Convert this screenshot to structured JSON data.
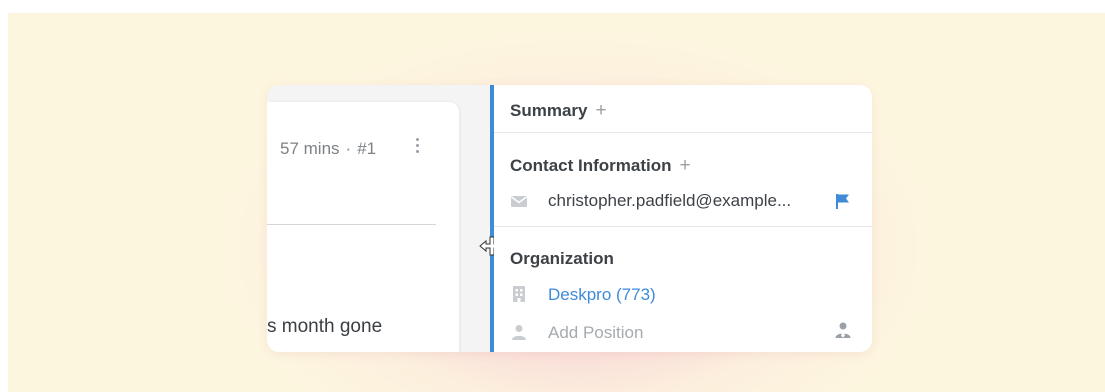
{
  "ticket_card": {
    "time_ago": "57 mins",
    "separator": "·",
    "ticket_number": "#1",
    "message_snippet": "s month gone"
  },
  "sidebar": {
    "summary": {
      "title": "Summary",
      "add_icon": "+"
    },
    "contact_information": {
      "title": "Contact Information",
      "add_icon": "+",
      "email": "christopher.padfield@example...",
      "email_icon": "envelope-icon",
      "primary_flag_icon": "flag-icon"
    },
    "organization": {
      "title": "Organization",
      "name": "Deskpro (773)",
      "org_icon": "building-icon",
      "position_placeholder": "Add Position",
      "position_icon": "person-icon",
      "manager_icon": "user-tie-icon"
    }
  },
  "colors": {
    "accent": "#3f8bd8",
    "link": "#3f8bd8",
    "background_warm": "#fdf6df",
    "background_pink": "#f6c6d3"
  }
}
